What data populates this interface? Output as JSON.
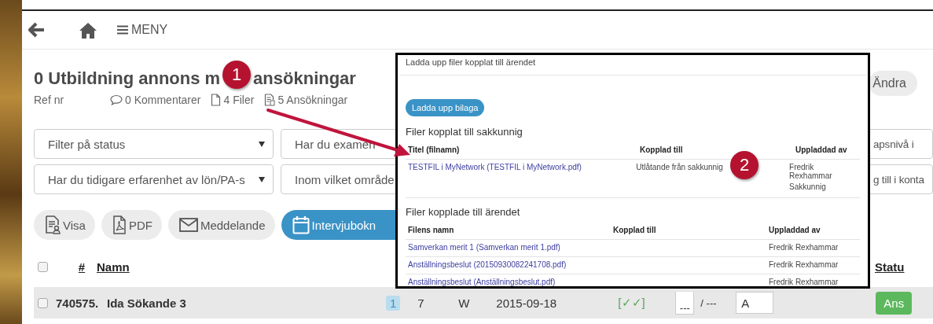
{
  "nav": {
    "menu_label": "MENY"
  },
  "header": {
    "title_start": "0 Utbildning annons m",
    "callout": "1",
    "title_end": "ansökningar",
    "ref": "Ref nr",
    "links": [
      {
        "kind": "comment",
        "label": "0 Kommentarer"
      },
      {
        "kind": "file",
        "label": "4 Filer"
      },
      {
        "kind": "list",
        "label": "5 Ansökningar"
      }
    ],
    "edit_button": "Ändra"
  },
  "filters": [
    [
      {
        "label": "Filter på status",
        "caret": true
      },
      {
        "label": "Har du examen",
        "caret": false
      },
      {
        "label": "apsnivå i",
        "caret": false
      }
    ],
    [
      {
        "label": "Har du tidigare erfarenhet av lön/PA-s",
        "caret": true
      },
      {
        "label": "Inom vilket område",
        "caret": false
      },
      {
        "label": "g till i konta",
        "caret": false
      }
    ]
  ],
  "actions": [
    {
      "kind": "document",
      "label": "Visa",
      "primary": false
    },
    {
      "kind": "pdf",
      "label": "PDF",
      "primary": false
    },
    {
      "kind": "mail",
      "label": "Meddelande",
      "primary": false
    },
    {
      "kind": "calendar",
      "label": "Intervjubokn",
      "primary": true
    }
  ],
  "table": {
    "select_all": {
      "checked": false
    },
    "columns": [
      {
        "label": "#"
      },
      {
        "label": "Namn"
      },
      {
        "label": "Statu"
      }
    ],
    "rows": [
      {
        "checked": false,
        "number": "740575.",
        "name": "Ida Sökande 3",
        "count": "1",
        "column_4": "7",
        "column_5": "W",
        "date": "2015-09-18",
        "checks": "[✓✓]",
        "score": "---",
        "score_max": "/ ---",
        "grade": "A",
        "status": "Ans"
      }
    ]
  },
  "popup": {
    "title": "Ladda upp filer kopplat till ärendet",
    "upload_button": "Ladda upp bilaga",
    "callout": "2",
    "sections": [
      {
        "heading": "Filer kopplat till sakkunnig",
        "columns": [
          "Titel (filnamn)",
          "Kopplad till",
          "Uppladdad av"
        ],
        "rows": [
          {
            "file": "TESTFIL i MyNetwork (TESTFIL i MyNetwork.pdf)",
            "linked_to": "Utlåtande från sakkunnig",
            "uploaded_by": [
              "Fredrik Rexhammar",
              "Sakkunnig"
            ]
          }
        ]
      },
      {
        "heading": "Filer kopplade till ärendet",
        "columns": [
          "Filens namn",
          "Kopplad till",
          "Uppladdad av"
        ],
        "rows": [
          {
            "file": "Samverkan merit 1 (Samverkan merit 1.pdf)",
            "uploaded_by": [
              "Fredrik Rexhammar"
            ]
          },
          {
            "file": "Anställningsbeslut (20150930082241708.pdf)",
            "uploaded_by": [
              "Fredrik Rexhammar"
            ]
          },
          {
            "file": "Anställningsbeslut (Anställningsbeslut.pdf)",
            "uploaded_by": [
              "Fredrik Rexhammar"
            ]
          }
        ]
      }
    ]
  }
}
